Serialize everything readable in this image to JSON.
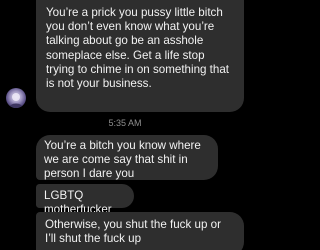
{
  "conversation": {
    "messages_top": [
      {
        "text": "You’re a prick you pussy little bitch you don’t even know what you’re talking about go be an asshole someplace else. Get a life stop trying to chime in on something that is not your business."
      }
    ],
    "timestamp": "5:35 AM",
    "messages_bottom": [
      {
        "text": "You’re a bitch you know where we are come say that shit in person I dare you"
      },
      {
        "text": "LGBTQ motherfucker"
      },
      {
        "text": "Otherwise, you shut the fuck up or I’ll shut the fuck up"
      }
    ]
  },
  "icons": {
    "avatar": "sender-avatar-icon"
  },
  "colors": {
    "background": "#000000",
    "bubble": "#2e2e2e",
    "text": "#f2f2f2",
    "timestamp": "#8e8e8e"
  }
}
